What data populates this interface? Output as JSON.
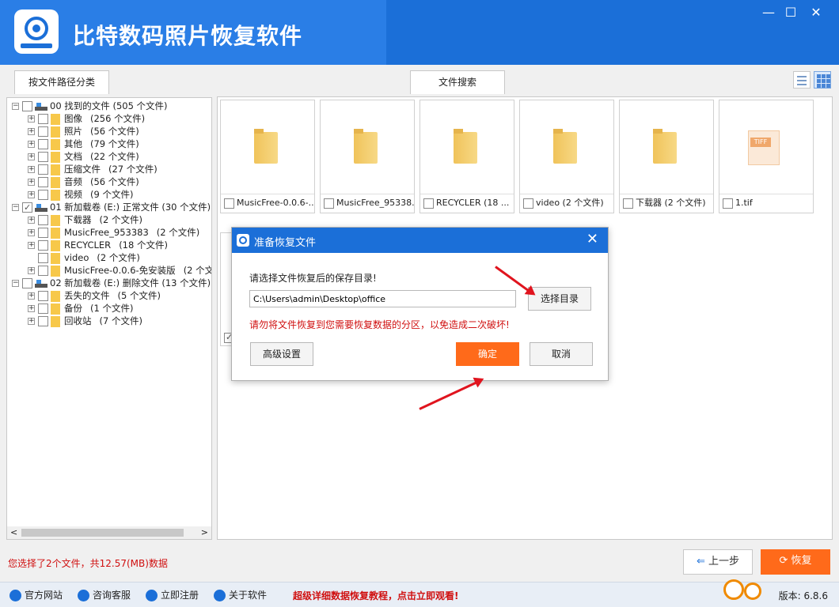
{
  "app": {
    "title": "比特数码照片恢复软件",
    "window_controls": [
      "—",
      "☐",
      "✕"
    ]
  },
  "tabs": {
    "path_tab": "按文件路径分类",
    "search_tab": "文件搜索"
  },
  "tree": {
    "nodes": [
      {
        "label": "00 找到的文件",
        "count": "(505 个文件)"
      },
      {
        "label": "图像",
        "count": "(256 个文件)"
      },
      {
        "label": "照片",
        "count": "(56 个文件)"
      },
      {
        "label": "其他",
        "count": "(79 个文件)"
      },
      {
        "label": "文档",
        "count": "(22 个文件)"
      },
      {
        "label": "压缩文件",
        "count": "(27 个文件)"
      },
      {
        "label": "音频",
        "count": "(56 个文件)"
      },
      {
        "label": "视频",
        "count": "(9 个文件)"
      },
      {
        "label": "01 新加载卷 (E:) 正常文件",
        "count": "(30 个文件)"
      },
      {
        "label": "下载器",
        "count": "(2 个文件)"
      },
      {
        "label": "MusicFree_953383",
        "count": "(2 个文件)"
      },
      {
        "label": "RECYCLER",
        "count": "(18 个文件)"
      },
      {
        "label": "video",
        "count": "(2 个文件)"
      },
      {
        "label": "MusicFree-0.0.6-免安装版",
        "count": "(2 个文"
      },
      {
        "label": "02 新加载卷 (E:) 删除文件",
        "count": "(13 个文件)"
      },
      {
        "label": "丢失的文件",
        "count": "(5 个文件)"
      },
      {
        "label": "备份",
        "count": "(1 个文件)"
      },
      {
        "label": "回收站",
        "count": "(7 个文件)"
      }
    ],
    "scroll_left": "<",
    "scroll_right": ">"
  },
  "tiles": [
    {
      "caption": "MusicFree-0.0.6-..."
    },
    {
      "caption": "MusicFree_95338..."
    },
    {
      "caption": "RECYCLER  (18 ..."
    },
    {
      "caption": "video  (2 个文件)"
    },
    {
      "caption": "下载器  (2 个文件)"
    },
    {
      "caption": "1.tif",
      "badge": "TIFF"
    }
  ],
  "dialog": {
    "title": "准备恢复文件",
    "close": "✕",
    "prompt": "请选择文件恢复后的保存目录!",
    "path_value": "C:\\Users\\admin\\Desktop\\office",
    "choose_dir": "选择目录",
    "warning": "请勿将文件恢复到您需要恢复数据的分区，以免造成二次破坏!",
    "advanced": "高级设置",
    "ok": "确定",
    "cancel": "取消"
  },
  "status": {
    "selection": "您选择了2个文件，共12.57(MB)数据"
  },
  "nav": {
    "prev": "上一步",
    "recover": "恢复"
  },
  "footer": {
    "links": [
      "官方网站",
      "咨询客服",
      "立即注册",
      "关于软件"
    ],
    "promo": "超级详细数据恢复教程，点击立即观看!",
    "version": "版本: 6.8.6"
  },
  "colors": {
    "brand_blue": "#1b6fd8",
    "accent_orange": "#ff6a1a",
    "warning_red": "#d01010"
  }
}
